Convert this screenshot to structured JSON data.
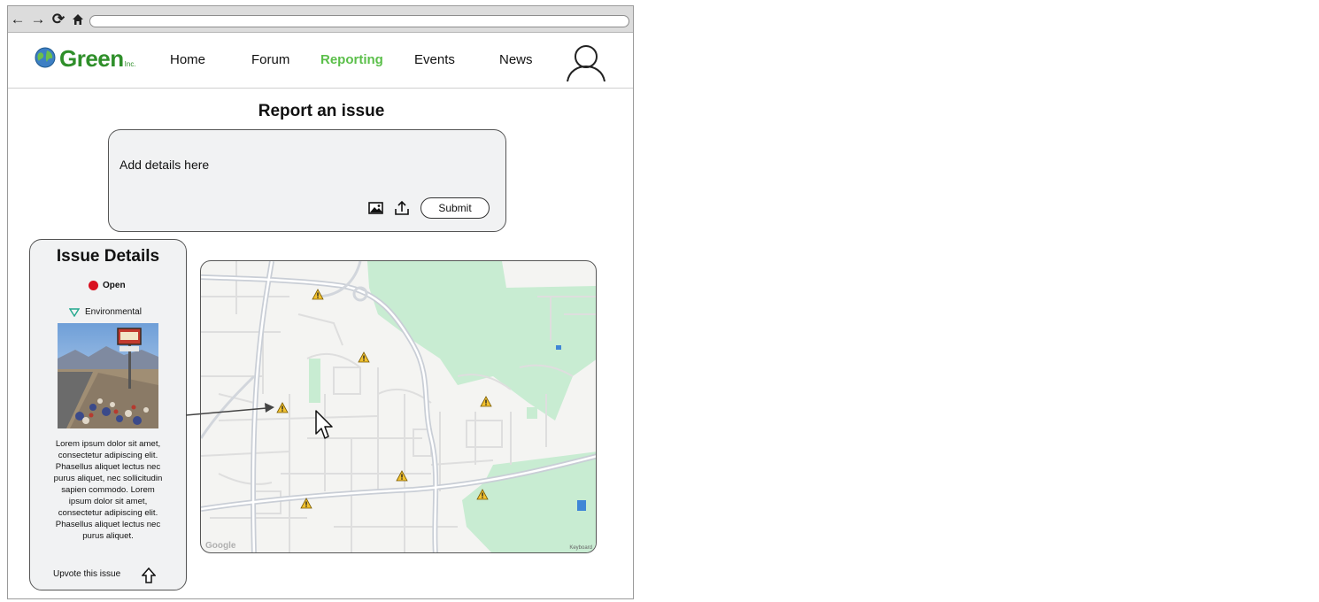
{
  "browser": {
    "nav_icons": [
      "back-arrow-icon",
      "forward-arrow-icon",
      "reload-icon",
      "home-icon"
    ],
    "url": ""
  },
  "header": {
    "logo_text": "Green",
    "logo_suffix": "Inc.",
    "nav": [
      {
        "label": "Home",
        "active": false
      },
      {
        "label": "Forum",
        "active": false
      },
      {
        "label": "Reporting",
        "active": true
      },
      {
        "label": "Events",
        "active": false
      },
      {
        "label": "News",
        "active": false
      }
    ],
    "colors": {
      "brand": "#2f8f2a",
      "active_link": "#5bbf4a"
    }
  },
  "report": {
    "title": "Report an issue",
    "placeholder": "Add details here",
    "submit_label": "Submit",
    "icons": [
      "image-icon",
      "upload-icon"
    ]
  },
  "issue": {
    "title": "Issue Details",
    "status": "Open",
    "status_color": "#d9101f",
    "category": "Environmental",
    "description": "Lorem ipsum dolor sit amet, consectetur adipiscing elit. Phasellus aliquet lectus nec purus aliquet, nec sollicitudin sapien commodo. Lorem ipsum dolor sit amet, consectetur adipiscing elit. Phasellus aliquet lectus nec purus aliquet.",
    "upvote_label": "Upvote this issue"
  },
  "map": {
    "attribution": "Google",
    "keyboard_label": "Keyboard",
    "marker_icon": "warning-icon",
    "marker_count": 7
  }
}
